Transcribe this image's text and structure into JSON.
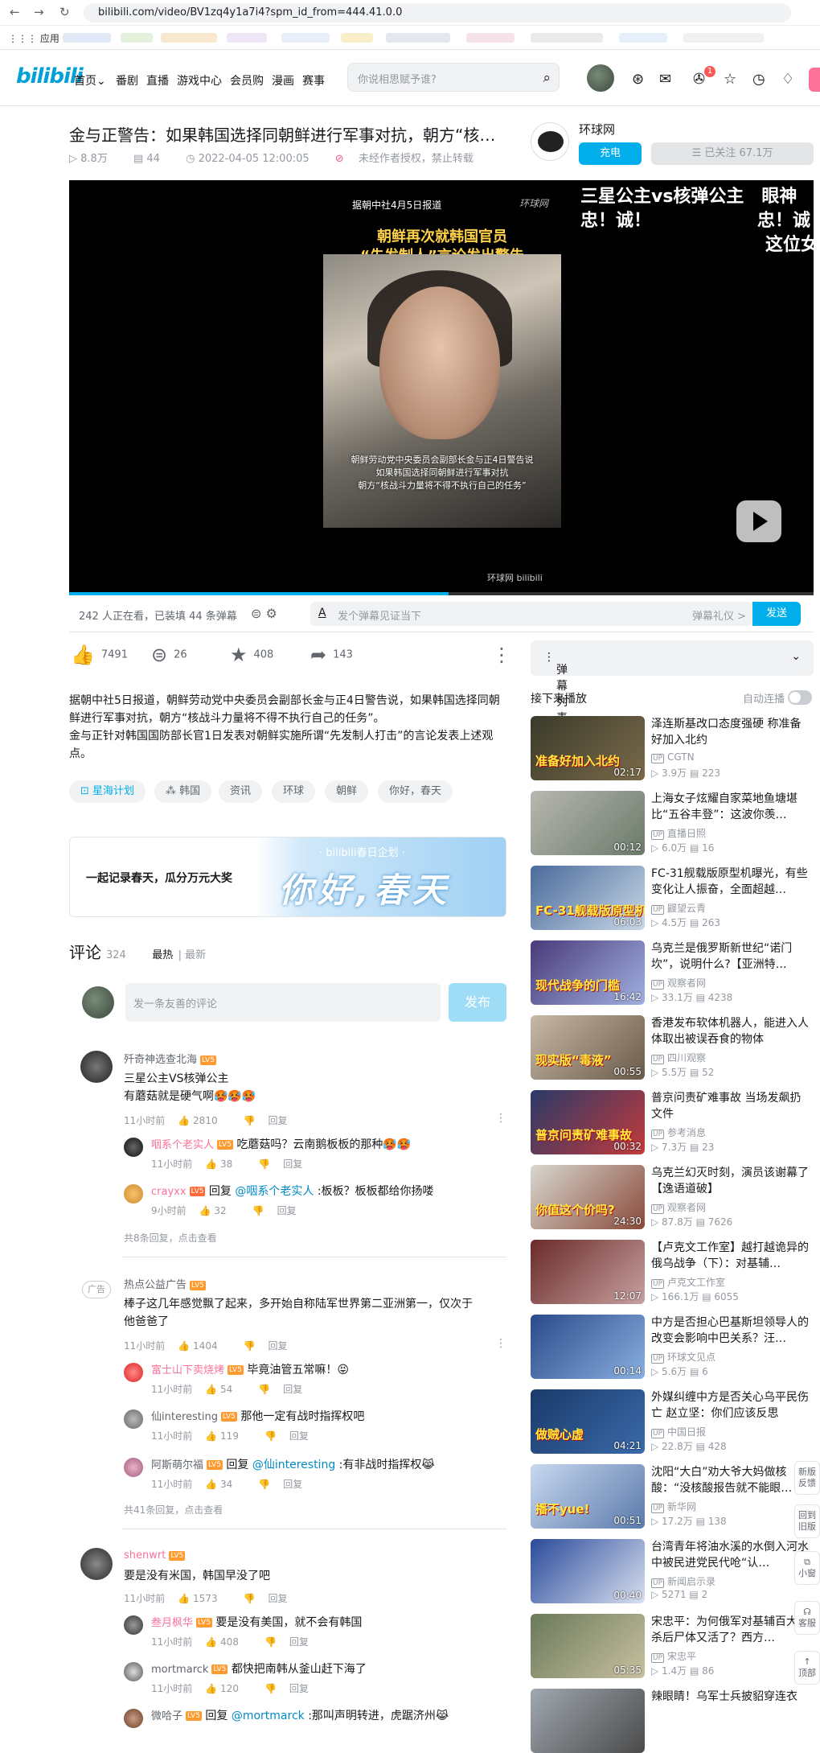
{
  "browser": {
    "url": "bilibili.com/video/BV1zq4y1a7i4?spm_id_from=444.41.0.0",
    "apps_label": "应用"
  },
  "header": {
    "logo": "bilibili",
    "nav": [
      "首页",
      "番剧",
      "直播",
      "游戏中心",
      "会员购",
      "漫画",
      "赛事"
    ],
    "search_placeholder": "你说相思赋予谁?",
    "notif_badge": "1"
  },
  "video": {
    "title": "金与正警告：如果韩国选择同朝鲜进行军事对抗，朝方“核…",
    "views": "8.8万",
    "danmaku": "44",
    "date": "2022-04-05 12:00:05",
    "notice": "未经作者授权，禁止转载",
    "player": {
      "top_caption": "据朝中社4月5日报道",
      "watermark": "环球网",
      "headline1": "朝鲜再次就韩国官员",
      "headline2": "“先发制人”言论发出警告",
      "sub1": "朝鲜劳动党中央委员会副部长金与正4日警告说",
      "sub2": "如果韩国选择同朝鲜进行军事对抗",
      "sub3": "朝方“核战斗力量将不得不执行自己的任务”",
      "danmu1": "三星公主vs核弹公主　眼神",
      "danmu2": "忠！诚！　　　　　　忠！诚",
      "danmu3": "这位女",
      "footer_logo": "环球网 bilibili"
    },
    "progress": 0.51
  },
  "up": {
    "name": "环球网",
    "charge": "充电",
    "follow": "已关注 67.1万"
  },
  "danmaku_bar": {
    "count": "242 人正在看，已装填 44 条弹幕",
    "placeholder": "发个弹幕见证当下",
    "etiquette": "弹幕礼仪 >",
    "send": "发送"
  },
  "actions": {
    "like": "7491",
    "coin": "26",
    "fav": "408",
    "share": "143"
  },
  "description": {
    "line1": "据朝中社5日报道，朝鲜劳动党中央委员会副部长金与正4日警告说，如果韩国选择同朝鲜进行军事对抗，朝方“核战斗力量将不得不执行自己的任务”。",
    "line2": "金与正针对韩国国防部长官1日发表对朝鲜实施所谓“先发制人打击”的言论发表上述观点。"
  },
  "tags": [
    "星海计划",
    "韩国",
    "资讯",
    "环球",
    "朝鲜",
    "你好，春天"
  ],
  "banner": {
    "left": "一起记录春天，瓜分万元大奖",
    "sub": "· bilibili春日企划 ·",
    "title": "你好,春天"
  },
  "comments": {
    "label": "评论",
    "count": "324",
    "sort_hot": "最热",
    "sort_new": "最新",
    "input_placeholder": "发一条友善的评论",
    "send": "发布",
    "list": [
      {
        "name": "歼奇神选查北海",
        "text1": "三星公主VS核弹公主",
        "text2": "有蘑菇就是硬气啊🥵🥵🥵",
        "time": "11小时前",
        "likes": "2810",
        "reply": "回复"
      },
      {
        "name": "热点公益广告",
        "text1": "棒子这几年感觉飘了起来，多开始自称陆军世界第二亚洲第一，仅次于",
        "text2": "他爸爸了",
        "time": "11小时前",
        "likes": "1404",
        "reply": "回复"
      },
      {
        "name": "shenwrt",
        "text1": "要是没有米国，韩国早没了吧",
        "time": "11小时前",
        "likes": "1573",
        "reply": "回复"
      }
    ],
    "replies": [
      {
        "name": "咽系个老实人",
        "text": "吃蘑菇吗？云南鹅板板的那种🥵🥵",
        "time": "11小时前",
        "likes": "38",
        "reply": "回复"
      },
      {
        "name": "crayxx",
        "pre": "回复 ",
        "at": "@咽系个老实人",
        "text": " :板板？板板都给你扬喽",
        "time": "9小时前",
        "likes": "32",
        "reply": "回复"
      },
      {
        "name": "富士山下卖烧烤",
        "text": "毕竟油管五常嘛！😝",
        "time": "11小时前",
        "likes": "54",
        "reply": "回复"
      },
      {
        "name": "仙interesting",
        "text": "那他一定有战时指挥权吧",
        "time": "11小时前",
        "likes": "119",
        "reply": "回复"
      },
      {
        "name": "阿斯萌尔福",
        "pre": "回复 ",
        "at": "@仙interesting",
        "text": " :有非战时指挥权😹",
        "time": "11小时前",
        "likes": "34",
        "reply": "回复"
      },
      {
        "name": "叁月枫华",
        "text": "要是没有美国，就不会有韩国",
        "time": "11小时前",
        "likes": "408",
        "reply": "回复"
      },
      {
        "name": "mortmarck",
        "text": "都快把南韩从釜山赶下海了",
        "time": "11小时前",
        "likes": "120",
        "reply": "回复"
      },
      {
        "name": "微哈子",
        "pre": "回复 ",
        "at": "@mortmarck",
        "text": " :那叫声明转进，虎踞济州😹",
        "time": "",
        "likes": "",
        "reply": ""
      }
    ],
    "more1": "共8条回复，点击查看",
    "more2": "共41条回复，点击查看",
    "ad_badge": "广告"
  },
  "sidebar": {
    "danmaku_list": "弹幕列表",
    "next_label": "接下来播放",
    "autoplay": "自动连播",
    "videos": [
      {
        "title": "泽连斯基改口态度强硬 称准备好加入北约",
        "up": "CGTN",
        "views": "3.9万",
        "dm": "223",
        "dur": "02:17",
        "overlay": "准备好加入北约"
      },
      {
        "title": "上海女子炫耀自家菜地鱼塘堪比“五谷丰登”：这波你羡…",
        "up": "直播日照",
        "views": "6.0万",
        "dm": "16",
        "dur": "00:12",
        "overlay": ""
      },
      {
        "title": "FC-31舰载版原型机曝光，有些变化让人振奋，全面超越…",
        "up": "鼹望云青",
        "views": "4.5万",
        "dm": "263",
        "dur": "06:03",
        "overlay": "FC-31舰载版原型机"
      },
      {
        "title": "乌克兰是俄罗斯新世纪“诺门坎”，说明什么?【亚洲特…",
        "up": "观察者网",
        "views": "33.1万",
        "dm": "4238",
        "dur": "16:42",
        "overlay": "现代战争的门槛"
      },
      {
        "title": "香港发布软体机器人，能进入人体取出被误吞食的物体",
        "up": "四川观察",
        "views": "5.5万",
        "dm": "52",
        "dur": "00:55",
        "overlay": "现实版“毒液”"
      },
      {
        "title": "普京问责矿难事故 当场发飙扔文件",
        "up": "参考消息",
        "views": "7.3万",
        "dm": "23",
        "dur": "00:32",
        "overlay": "普京问责矿难事故"
      },
      {
        "title": "乌克兰幻灭时刻，演员该谢幕了【逸语道破】",
        "up": "观察者网",
        "views": "87.8万",
        "dm": "7626",
        "dur": "24:30",
        "overlay": "你值这个价吗?"
      },
      {
        "title": "【卢克文工作室】越打越诡异的俄乌战争（下）：对基辅…",
        "up": "卢克文工作室",
        "views": "166.1万",
        "dm": "6055",
        "dur": "12:07",
        "overlay": ""
      },
      {
        "title": "中方是否担心巴基斯坦领导人的改变会影响中巴关系？汪…",
        "up": "环球文见点",
        "views": "5.6万",
        "dm": "6",
        "dur": "00:14",
        "overlay": ""
      },
      {
        "title": "外媒纠缠中方是否关心乌平民伤亡 赵立坚：你们应该反思",
        "up": "中国日报",
        "views": "22.8万",
        "dm": "428",
        "dur": "04:21",
        "overlay": "做贼心虚"
      },
      {
        "title": "沈阳“大白”劝大爷大妈做核酸：“没核酸报告就不能眼…",
        "up": "新华网",
        "views": "17.2万",
        "dm": "138",
        "dur": "00:51",
        "overlay": "播不yue!"
      },
      {
        "title": "台湾青年将油水溪的水倒入河水中被民进党民代呛“认…",
        "up": "新闻启示录",
        "views": "5271",
        "dm": "2",
        "dur": "00:40",
        "overlay": ""
      },
      {
        "title": "宋忠平：为何俄军对基辅百大屠杀后尸体又活了？西方…",
        "up": "宋忠平",
        "views": "1.4万",
        "dm": "86",
        "dur": "05:35",
        "overlay": ""
      },
      {
        "title": "辣眼睛！乌军士兵披貂穿连衣",
        "up": "",
        "views": "",
        "dm": "",
        "dur": "",
        "overlay": ""
      }
    ]
  },
  "floating": {
    "new_feedback": "新版反馈",
    "back_old": "回到旧版",
    "mini": "小窗",
    "service": "客服",
    "top": "顶部"
  }
}
